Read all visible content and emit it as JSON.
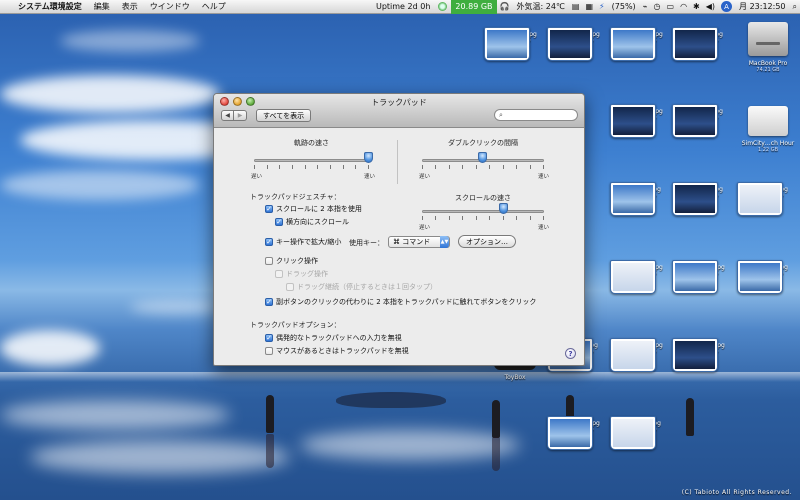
{
  "menubar": {
    "apple": "",
    "app": "システム環境設定",
    "menus": [
      "編集",
      "表示",
      "ウインドウ",
      "ヘルプ"
    ],
    "uptime": "Uptime 2d 0h",
    "disk": "20.89 GB",
    "temp": "外気温: 24℃",
    "battery": "(75%)",
    "spotlight": "A",
    "clock": "月 23:12:50"
  },
  "window": {
    "title": "トラックパッド",
    "back": "◀",
    "forward": "▶",
    "show_all": "すべてを表示",
    "search_placeholder": ""
  },
  "tracking": {
    "label": "軌跡の速さ",
    "slow": "遅い",
    "fast": "速い",
    "value": 1.0
  },
  "doubleclick": {
    "label": "ダブルクリックの間隔",
    "slow": "遅い",
    "fast": "速い",
    "value": 0.5
  },
  "scrollspeed": {
    "label": "スクロールの速さ",
    "slow": "遅い",
    "fast": "速い",
    "value": 0.67
  },
  "gestures": {
    "heading": "トラックパッドジェスチャ：",
    "two_finger_scroll": "スクロールに 2 本指を使用",
    "horizontal_scroll": "横方向にスクロール",
    "zoom": "キー操作で拡大/縮小",
    "modifier_label": "使用キー：",
    "modifier_value": "⌘ コマンド",
    "options": "オプション…",
    "tap_click": "クリック操作",
    "drag": "ドラッグ操作",
    "drag_lock": "ドラッグ継続（停止するときは１回タップ）",
    "secondary": "副ボタンのクリックの代わりに 2 本指をトラックパッドに触れてボタンをクリック"
  },
  "options_section": {
    "heading": "トラックパッドオプション：",
    "ignore_accidental": "偶発的なトラックパッドへの入力を無視",
    "ignore_with_mouse": "マウスがあるときはトラックパッドを無視"
  },
  "help": "?",
  "desktop": {
    "icons": [
      {
        "name": "capture 23.jpg",
        "size": "1,440 × 900"
      },
      {
        "name": "capture 17.jpg",
        "size": "1,440 × 900"
      },
      {
        "name": "capture 11.jpg",
        "size": "1,440 × 900"
      },
      {
        "name": "capture 5.jpg",
        "size": "1,440 × 900"
      },
      {
        "name": "capture 12.jpg",
        "size": "1,440 × 900"
      },
      {
        "name": "capture 6.jpg",
        "size": "1,440 × 900"
      },
      {
        "name": "capture 7.jpg",
        "size": "1,440 × 900"
      },
      {
        "name": "capture 1.jpg",
        "size": "1,440 × 900"
      },
      {
        "name": "capture 2.jpg",
        "size": "1,440 × 900"
      },
      {
        "name": "capture 21.jpg",
        "size": "1,440 × 900"
      },
      {
        "name": "capture 15.jpg",
        "size": "1,440 × 900"
      },
      {
        "name": "capture 9.jpg",
        "size": "1,440 × 900"
      },
      {
        "name": "capture 3.jpg",
        "size": "1,440 × 900"
      },
      {
        "name": "capture 22.jpg",
        "size": "1,440 × 900"
      },
      {
        "name": "capture 16.jpg",
        "size": "1,440 × 900"
      },
      {
        "name": "capture 10.jpg",
        "size": "1,440 × 900"
      },
      {
        "name": "capture 4.jpg",
        "size": "1,440 × 900"
      }
    ],
    "hd_name": "MacBook Pro",
    "hd_size": "74.21 GB",
    "drive_name": "SimCity…ch Hour",
    "drive_size": "1.22 GB",
    "toy_name": "ToyBox",
    "copyright": "(C) Tabioto All Rights Reserved."
  }
}
